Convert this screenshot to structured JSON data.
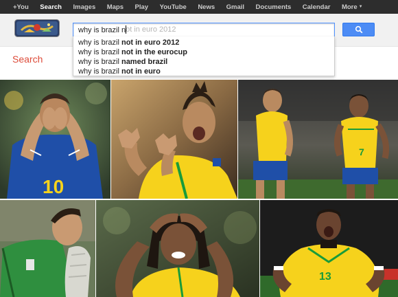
{
  "gbar": {
    "items": [
      {
        "label": "+You",
        "active": false
      },
      {
        "label": "Search",
        "active": true
      },
      {
        "label": "Images",
        "active": false
      },
      {
        "label": "Maps",
        "active": false
      },
      {
        "label": "Play",
        "active": false
      },
      {
        "label": "YouTube",
        "active": false
      },
      {
        "label": "News",
        "active": false
      },
      {
        "label": "Gmail",
        "active": false
      },
      {
        "label": "Documents",
        "active": false
      },
      {
        "label": "Calendar",
        "active": false
      },
      {
        "label": "More",
        "active": false
      }
    ]
  },
  "search": {
    "typed": "why is brazil n",
    "ghost_tail": "ot in euro 2012",
    "button_icon": "search-icon"
  },
  "suggestions": [
    {
      "prefix": "why is brazil ",
      "bold": "not in euro 2012"
    },
    {
      "prefix": "why is brazil ",
      "bold": "not in the eurocup"
    },
    {
      "prefix": "why is brazil ",
      "bold": "named brazil"
    },
    {
      "prefix": "why is brazil ",
      "bold": "not in euro"
    }
  ],
  "left_label": "Search",
  "photos": [
    {
      "caption_number": "10"
    },
    {
      "caption_number": ""
    },
    {
      "caption_number": "7"
    },
    {
      "caption_number": ""
    },
    {
      "caption_number": ""
    },
    {
      "caption_number": "13"
    }
  ],
  "colors": {
    "gbar_bg": "#2d2d2d",
    "accent_blue": "#4d8cf5",
    "brazil_yellow": "#f6d21c",
    "brazil_blue": "#1f4fa8",
    "brazil_green": "#199b3a",
    "red_label": "#dd4b39"
  }
}
